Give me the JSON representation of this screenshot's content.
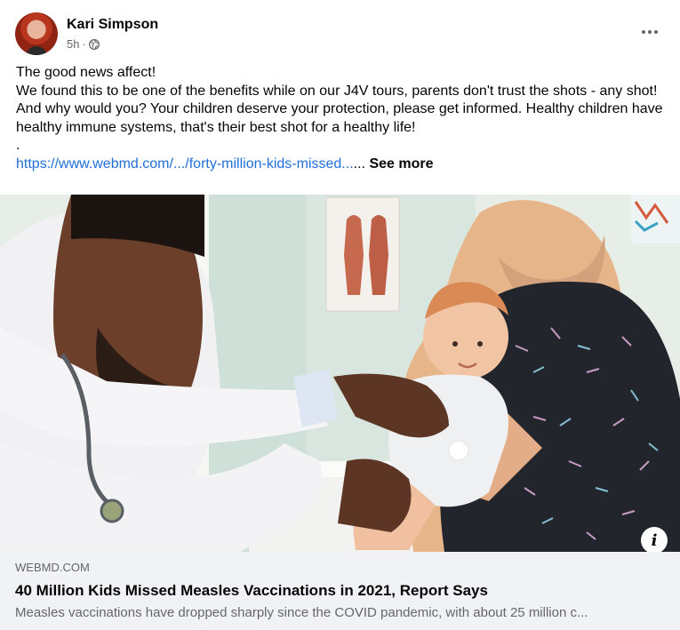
{
  "post": {
    "author": "Kari Simpson",
    "time": "5h",
    "separator": "·",
    "privacy_icon": "globe-icon",
    "more_icon": "more-options-icon",
    "lines": [
      "The good news affect!",
      "We found this to be one of the benefits while on our J4V tours, parents don't trust the shots - any shot!  And why would you?  Your children deserve your protection, please get informed.  Healthy children have healthy immune systems, that's their best shot for a healthy life!",
      "."
    ],
    "link_text": "https://www.webmd.com/.../forty-million-kids-missed...",
    "ellipsis": "...",
    "see_more": "See more"
  },
  "media": {
    "info_label": "i",
    "chart_text": ""
  },
  "preview": {
    "domain": "WEBMD.COM",
    "title": "40 Million Kids Missed Measles Vaccinations in 2021, Report Says",
    "description": "Measles vaccinations have dropped sharply since the COVID pandemic, with about 25 million c..."
  },
  "colors": {
    "link": "#216fdb",
    "secondary_text": "#65676b",
    "preview_bg": "#f0f2f5"
  }
}
